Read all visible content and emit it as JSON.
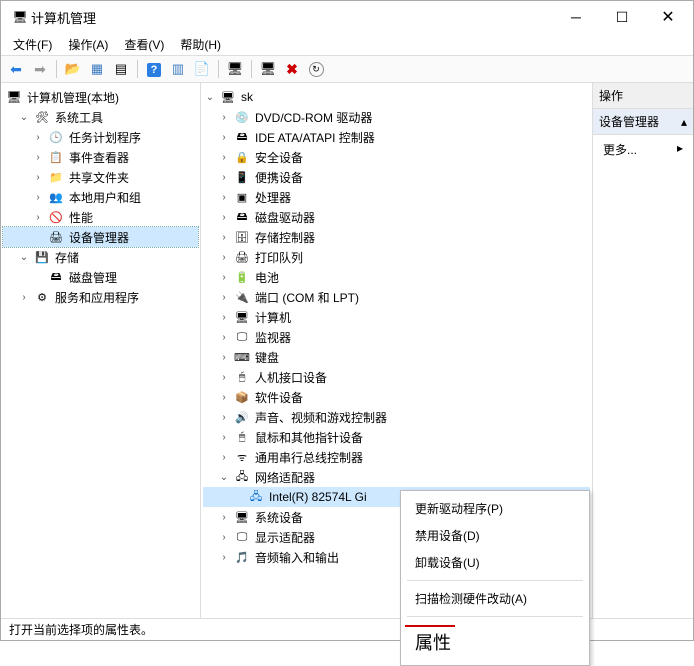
{
  "window": {
    "title": "计算机管理"
  },
  "menu": {
    "file": "文件(F)",
    "action": "操作(A)",
    "view": "查看(V)",
    "help": "帮助(H)"
  },
  "left_tree": {
    "root": "计算机管理(本地)",
    "sys_tools": "系统工具",
    "task_sched": "任务计划程序",
    "event_viewer": "事件查看器",
    "shared": "共享文件夹",
    "users": "本地用户和组",
    "perf": "性能",
    "devmgr": "设备管理器",
    "storage": "存储",
    "diskmgmt": "磁盘管理",
    "services": "服务和应用程序"
  },
  "center": {
    "root": "sk",
    "cat": {
      "dvd": "DVD/CD-ROM 驱动器",
      "ide": "IDE ATA/ATAPI 控制器",
      "sec": "安全设备",
      "port": "便携设备",
      "cpu": "处理器",
      "hdd": "磁盘驱动器",
      "stor": "存储控制器",
      "prn": "打印队列",
      "bat": "电池",
      "com": "端口 (COM 和 LPT)",
      "pc": "计算机",
      "mon": "监视器",
      "kbd": "键盘",
      "hid": "人机接口设备",
      "sw": "软件设备",
      "snd": "声音、视频和游戏控制器",
      "mouse": "鼠标和其他指针设备",
      "usb": "通用串行总线控制器",
      "net": "网络适配器",
      "nic": "Intel(R) 82574L Gi",
      "sys": "系统设备",
      "disp": "显示适配器",
      "audio": "音频输入和输出"
    }
  },
  "ctx": {
    "update": "更新驱动程序(P)",
    "disable": "禁用设备(D)",
    "uninstall": "卸载设备(U)",
    "scan": "扫描检测硬件改动(A)",
    "prop": "属性"
  },
  "right": {
    "header": "操作",
    "sub": "设备管理器",
    "more": "更多..."
  },
  "status": "打开当前选择项的属性表。"
}
